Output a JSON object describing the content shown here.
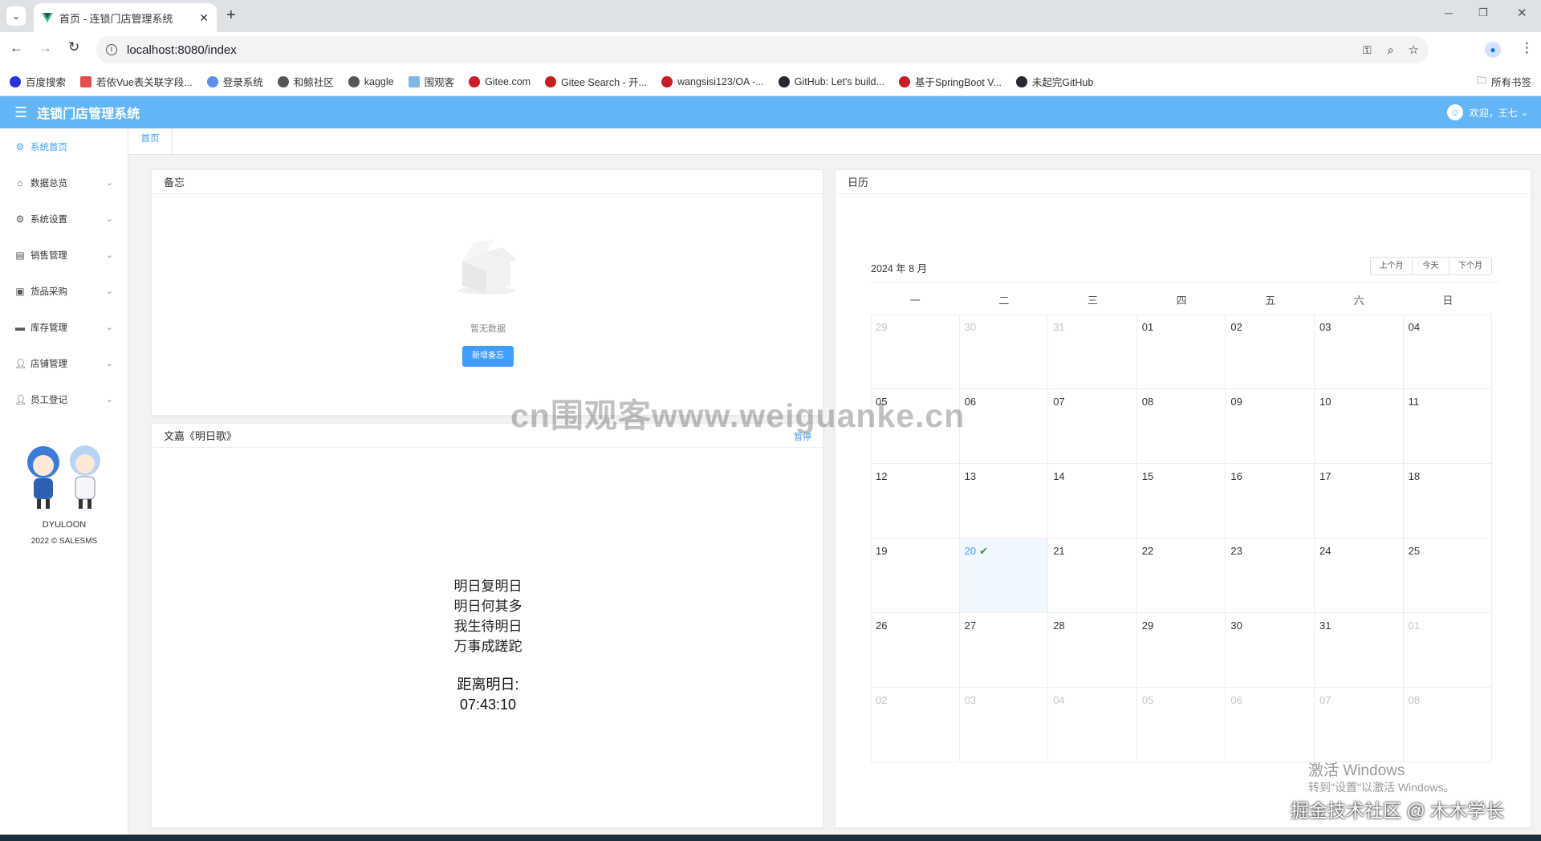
{
  "browser": {
    "tab_title": "首页 - 连锁门店管理系统",
    "url": "localhost:8080/index",
    "bookmarks": [
      "百度搜索",
      "若依Vue表关联字段...",
      "登录系统",
      "和鲸社区",
      "kaggle",
      "围观客",
      "Gitee.com",
      "Gitee Search - 开...",
      "wangsisi123/OA -...",
      "GitHub: Let's build...",
      "基于SpringBoot V...",
      "未起完GitHub"
    ],
    "all_bookmarks": "所有书签"
  },
  "app": {
    "title": "连锁门店管理系统",
    "welcome": "欢迎，王七",
    "colors": {
      "header": "#62b6f6",
      "accent": "#409eff"
    }
  },
  "sidebar": {
    "items": [
      {
        "label": "系统首页",
        "icon": "gear-outline-icon",
        "active": true
      },
      {
        "label": "数据总览",
        "icon": "home-icon"
      },
      {
        "label": "系统设置",
        "icon": "gear-icon"
      },
      {
        "label": "销售管理",
        "icon": "chart-icon"
      },
      {
        "label": "货品采购",
        "icon": "bag-icon"
      },
      {
        "label": "库存管理",
        "icon": "box-icon"
      },
      {
        "label": "店铺管理",
        "icon": "user-icon"
      },
      {
        "label": "员工登记",
        "icon": "user-icon"
      }
    ],
    "mascot_name": "DYULOON",
    "copyright": "2022 © SALESMS"
  },
  "tags": {
    "home": "首页"
  },
  "memo": {
    "title": "备忘",
    "empty_text": "暂无数据",
    "add_button": "新增备忘"
  },
  "poem": {
    "title": "文嘉《明日歌》",
    "pause": "暂停",
    "lines": [
      "明日复明日",
      "明日何其多",
      "我生待明日",
      "万事成蹉跎"
    ],
    "countdown_label": "距离明日:",
    "countdown_value": "07:43:10"
  },
  "calendar": {
    "title": "日历",
    "month_label": "2024 年 8 月",
    "prev": "上个月",
    "today": "今天",
    "next": "下个月",
    "weekdays": [
      "一",
      "二",
      "三",
      "四",
      "五",
      "六",
      "日"
    ],
    "weeks": [
      [
        "29",
        "30",
        "31",
        "01",
        "02",
        "03",
        "04"
      ],
      [
        "05",
        "06",
        "07",
        "08",
        "09",
        "10",
        "11"
      ],
      [
        "12",
        "13",
        "14",
        "15",
        "16",
        "17",
        "18"
      ],
      [
        "19",
        "20",
        "21",
        "22",
        "23",
        "24",
        "25"
      ],
      [
        "26",
        "27",
        "28",
        "29",
        "30",
        "31",
        "01"
      ],
      [
        "02",
        "03",
        "04",
        "05",
        "06",
        "07",
        "08"
      ]
    ],
    "selected_day": "20"
  },
  "overlays": {
    "watermark": "cn围观客www.weiguanke.cn",
    "activate_title": "激活 Windows",
    "activate_sub": "转到\"设置\"以激活 Windows。",
    "juejin": "掘金技术社区 @ 木木学长"
  }
}
